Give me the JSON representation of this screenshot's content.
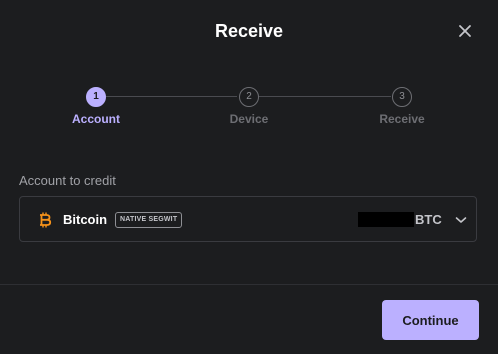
{
  "dialog": {
    "title": "Receive",
    "close_icon": "close-icon"
  },
  "stepper": {
    "steps": [
      {
        "number": "1",
        "label": "Account",
        "active": true
      },
      {
        "number": "2",
        "label": "Device",
        "active": false
      },
      {
        "number": "3",
        "label": "Receive",
        "active": false
      }
    ],
    "active_color": "#bbb0ff"
  },
  "account_section": {
    "label": "Account to credit",
    "selected_account": {
      "icon": "bitcoin-icon",
      "icon_color": "#f7931a",
      "name": "Bitcoin",
      "badge": "NATIVE SEGWIT",
      "balance_unit": "BTC",
      "balance_redacted": true
    },
    "dropdown_icon": "chevron-down-icon"
  },
  "footer": {
    "continue_label": "Continue"
  }
}
